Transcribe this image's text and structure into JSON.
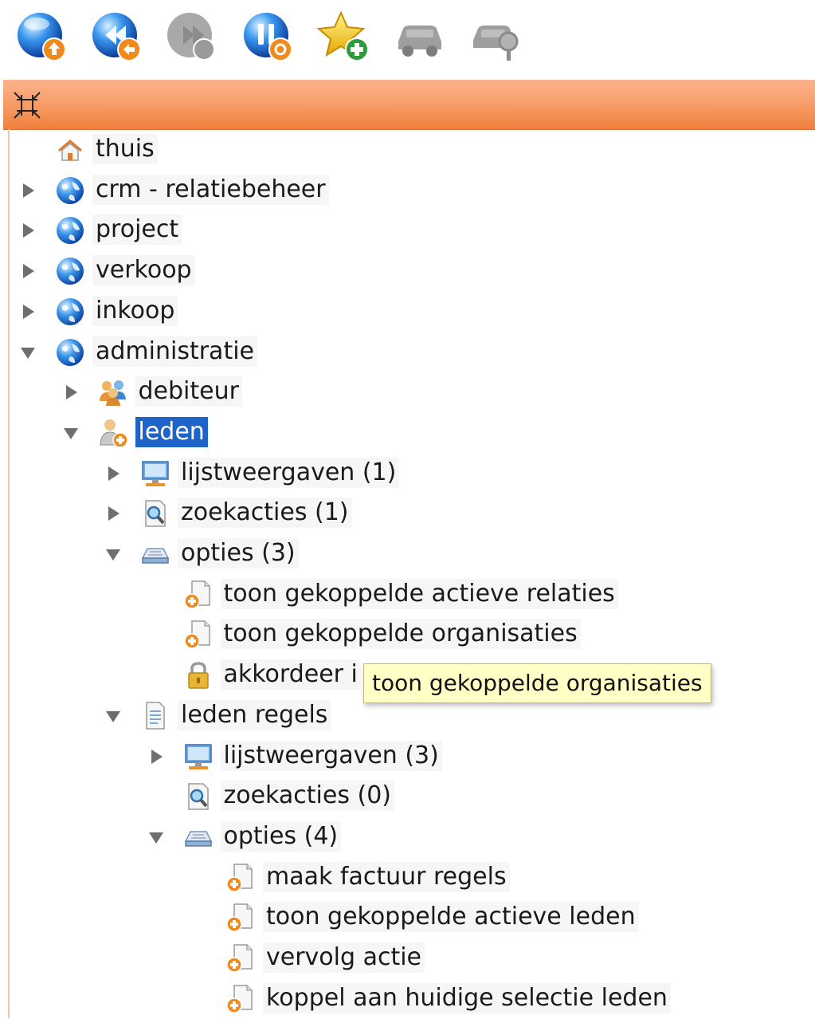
{
  "toolbar": {
    "buttons": [
      {
        "icon": "globe-upload-icon",
        "enabled": true
      },
      {
        "icon": "globe-rewind-icon",
        "enabled": true
      },
      {
        "icon": "globe-forward-icon",
        "enabled": false
      },
      {
        "icon": "globe-pause-icon",
        "enabled": true
      },
      {
        "icon": "star-add-icon",
        "enabled": true
      },
      {
        "icon": "car-icon",
        "enabled": false
      },
      {
        "icon": "car-search-icon",
        "enabled": false
      }
    ]
  },
  "header": {
    "collapse_icon": "collapse-arrows-icon",
    "accent_color": "#f79a64"
  },
  "tree": {
    "selected_color": "#1e63c7",
    "nodes": [
      {
        "label": "thuis",
        "icon": "home-icon",
        "level": 0,
        "toggle": "none"
      },
      {
        "label": "crm - relatiebeheer",
        "icon": "globe-icon",
        "level": 0,
        "toggle": "collapsed"
      },
      {
        "label": "project",
        "icon": "globe-icon",
        "level": 0,
        "toggle": "collapsed"
      },
      {
        "label": "verkoop",
        "icon": "globe-icon",
        "level": 0,
        "toggle": "collapsed"
      },
      {
        "label": "inkoop",
        "icon": "globe-icon",
        "level": 0,
        "toggle": "collapsed"
      },
      {
        "label": "administratie",
        "icon": "globe-icon",
        "level": 0,
        "toggle": "expanded"
      },
      {
        "label": "debiteur",
        "icon": "users-icon",
        "level": 1,
        "toggle": "collapsed"
      },
      {
        "label": "leden",
        "icon": "user-add-icon",
        "level": 1,
        "toggle": "expanded",
        "selected": true
      },
      {
        "label": "lijstweergaven (1)",
        "icon": "monitor-icon",
        "level": 2,
        "toggle": "collapsed"
      },
      {
        "label": "zoekacties (1)",
        "icon": "search-document-icon",
        "level": 2,
        "toggle": "collapsed"
      },
      {
        "label": "opties (3)",
        "icon": "tray-icon",
        "level": 2,
        "toggle": "expanded"
      },
      {
        "label": "toon gekoppelde actieve relaties",
        "icon": "document-add-icon",
        "level": 3,
        "toggle": "none"
      },
      {
        "label": "toon gekoppelde organisaties",
        "icon": "document-add-icon",
        "level": 3,
        "toggle": "none"
      },
      {
        "label": "akkordeer i",
        "icon": "lock-icon",
        "level": 3,
        "toggle": "none"
      },
      {
        "label": "leden regels",
        "icon": "document-icon",
        "level": 2,
        "toggle": "expanded"
      },
      {
        "label": "lijstweergaven (3)",
        "icon": "monitor-icon",
        "level": 3,
        "toggle": "collapsed"
      },
      {
        "label": "zoekacties (0)",
        "icon": "search-document-icon",
        "level": 3,
        "toggle": "none"
      },
      {
        "label": "opties (4)",
        "icon": "tray-icon",
        "level": 3,
        "toggle": "expanded"
      },
      {
        "label": "maak factuur regels",
        "icon": "document-add-icon",
        "level": 4,
        "toggle": "none"
      },
      {
        "label": "toon gekoppelde actieve leden",
        "icon": "document-add-icon",
        "level": 4,
        "toggle": "none"
      },
      {
        "label": "vervolg actie",
        "icon": "document-add-icon",
        "level": 4,
        "toggle": "none"
      },
      {
        "label": "koppel aan huidige selectie leden",
        "icon": "document-add-icon",
        "level": 4,
        "toggle": "none"
      }
    ]
  },
  "tooltip": {
    "text": "toon gekoppelde organisaties"
  }
}
